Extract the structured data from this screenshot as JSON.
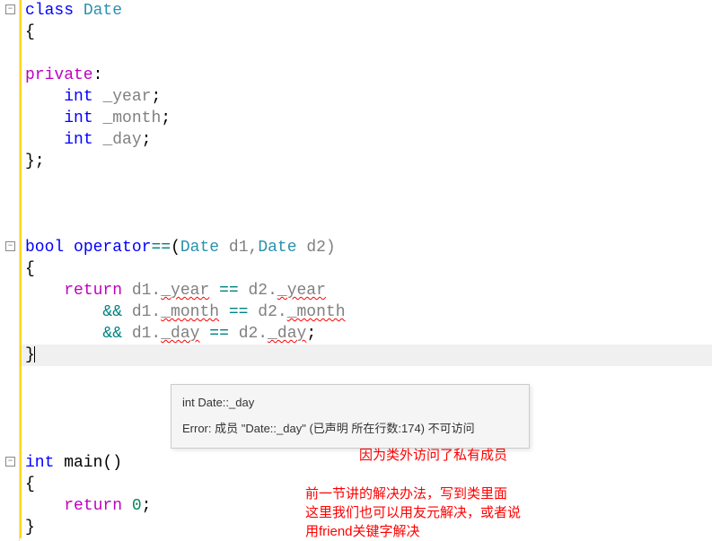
{
  "code": {
    "l1_class": "class",
    "l1_Date": "Date",
    "l2_brace": "{",
    "l3_empty": "",
    "l4_private": "private",
    "l4_colon": ":",
    "l5_int": "int",
    "l5_year": "_year",
    "l6_int": "int",
    "l6_month": "_month",
    "l7_int": "int",
    "l7_day": "_day",
    "l8_close": "};",
    "l9_empty": "",
    "l10_bool": "bool",
    "l10_operator": "operator",
    "l10_eq": "==",
    "l10_p1": "(",
    "l10_Date1": "Date",
    "l10_d1": " d1,",
    "l10_Date2": "Date",
    "l10_d2": " d2)",
    "l11_brace": "{",
    "l12_return": "return",
    "l12_d1": " d1.",
    "l12_year": "_year",
    "l12_eq": " == ",
    "l12_d2": "d2.",
    "l12_year2": "_year",
    "l13_and": "&&",
    "l13_d1": " d1.",
    "l13_month": "_month",
    "l13_eq": " == ",
    "l13_d2": "d2.",
    "l13_month2": "_month",
    "l14_and": "&&",
    "l14_d1": " d1.",
    "l14_day": "_day",
    "l14_eq": " == ",
    "l14_d2": "d2.",
    "l14_day2": "_day",
    "l14_semi": ";",
    "l15_close": "}",
    "l16_empty": "",
    "l17_int": "int",
    "l17_main": " main()",
    "l18_brace": "{",
    "l19_return": "return",
    "l19_zero": "0",
    "l19_semi": ";",
    "l20_close": "}"
  },
  "tooltip": {
    "title": "int Date::_day",
    "error": "Error: 成员 \"Date::_day\" (已声明 所在行数:174) 不可访问"
  },
  "annotations": {
    "a1": "因为类外访问了私有成员",
    "a2": "前一节讲的解决办法，写到类里面\n这里我们也可以用友元解决，或者说\n用friend关键字解决"
  },
  "fold_glyph": "−"
}
